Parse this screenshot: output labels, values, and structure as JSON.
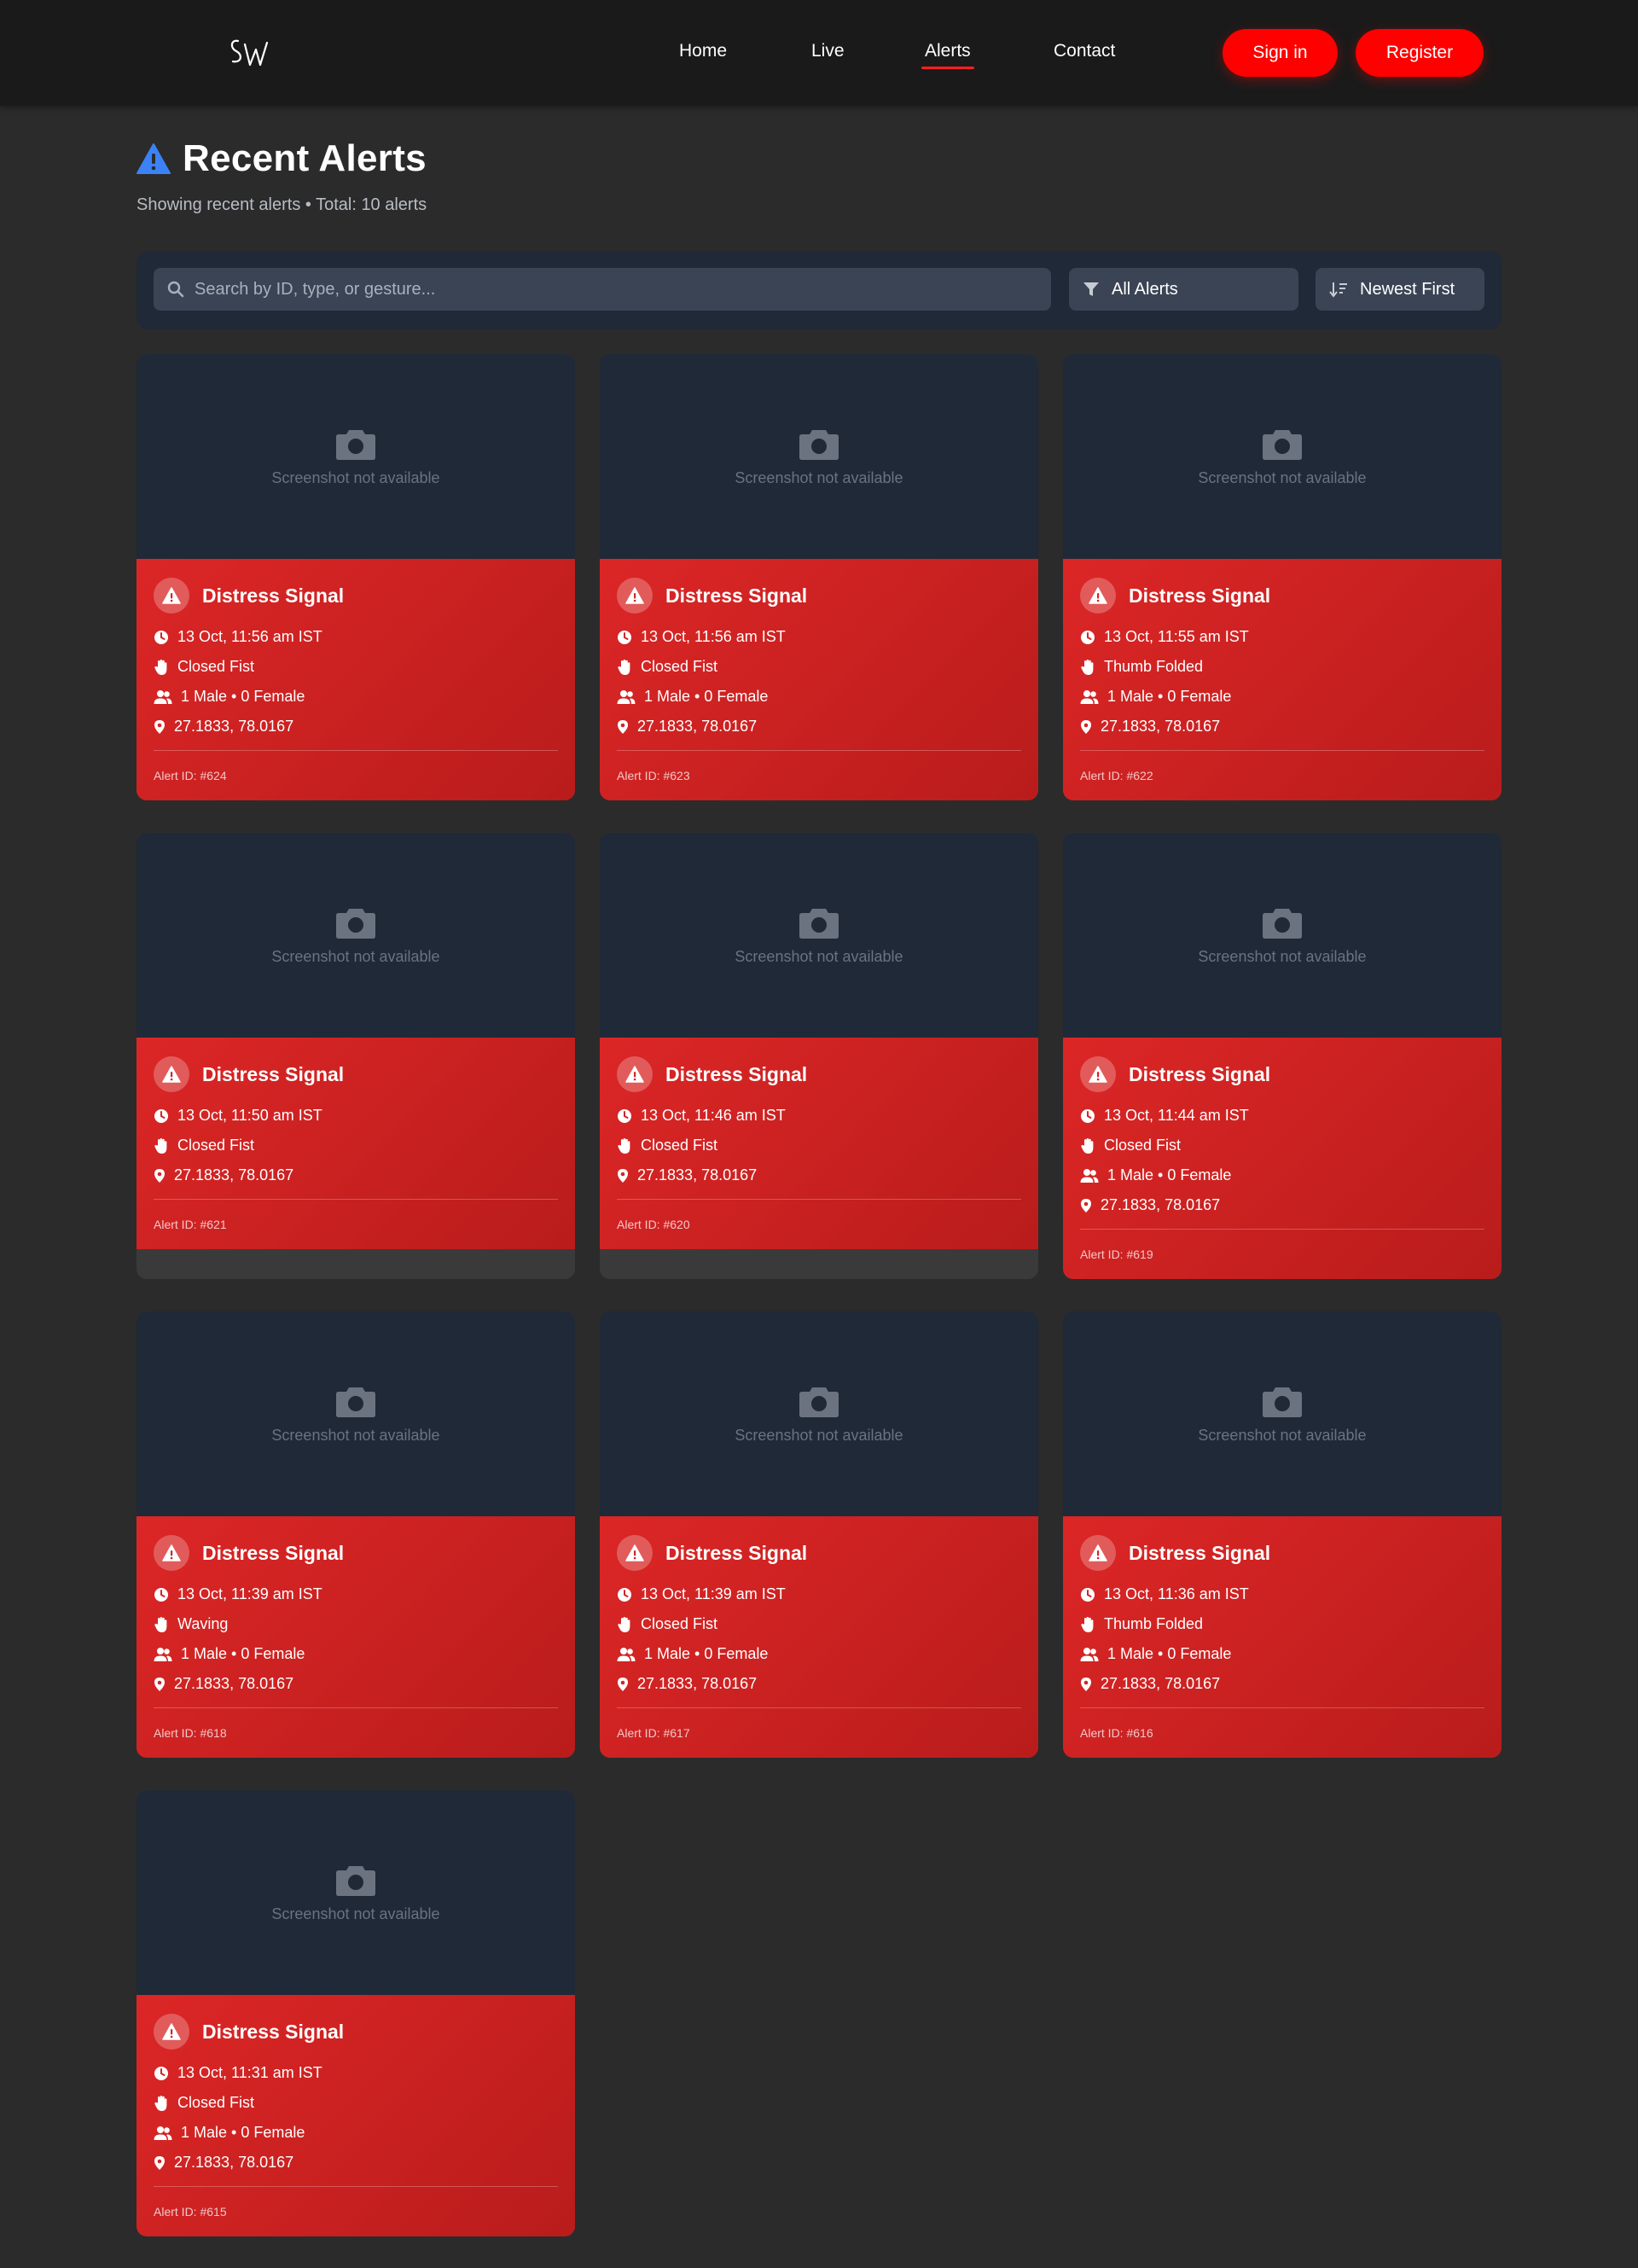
{
  "nav": {
    "logo_text": "SW",
    "links": [
      {
        "label": "Home",
        "active": false
      },
      {
        "label": "Live",
        "active": false
      },
      {
        "label": "Alerts",
        "active": true
      },
      {
        "label": "Contact",
        "active": false
      }
    ],
    "signin_label": "Sign in",
    "register_label": "Register"
  },
  "header": {
    "title": "Recent Alerts",
    "subtitle": "Showing recent alerts • Total: 10 alerts",
    "icon": "warning-icon"
  },
  "filters": {
    "search_placeholder": "Search by ID, type, or gesture...",
    "type_filter": "All Alerts",
    "sort": "Newest First"
  },
  "colors": {
    "accent": "#ff0000",
    "card_red": "#dc2626",
    "title_icon": "#3b82f6",
    "panel": "#1f2937",
    "background": "#2b2b2b"
  },
  "screenshot_placeholder": "Screenshot not available",
  "alerts": [
    {
      "title": "Distress Signal",
      "time": "13 Oct, 11:56 am IST",
      "gesture": "Closed Fist",
      "people": "1 Male • 0 Female",
      "location": "27.1833, 78.0167",
      "id": "Alert ID: #624"
    },
    {
      "title": "Distress Signal",
      "time": "13 Oct, 11:56 am IST",
      "gesture": "Closed Fist",
      "people": "1 Male • 0 Female",
      "location": "27.1833, 78.0167",
      "id": "Alert ID: #623"
    },
    {
      "title": "Distress Signal",
      "time": "13 Oct, 11:55 am IST",
      "gesture": "Thumb Folded",
      "people": "1 Male • 0 Female",
      "location": "27.1833, 78.0167",
      "id": "Alert ID: #622"
    },
    {
      "title": "Distress Signal",
      "time": "13 Oct, 11:50 am IST",
      "gesture": "Closed Fist",
      "people": null,
      "location": "27.1833, 78.0167",
      "id": "Alert ID: #621"
    },
    {
      "title": "Distress Signal",
      "time": "13 Oct, 11:46 am IST",
      "gesture": "Closed Fist",
      "people": null,
      "location": "27.1833, 78.0167",
      "id": "Alert ID: #620"
    },
    {
      "title": "Distress Signal",
      "time": "13 Oct, 11:44 am IST",
      "gesture": "Closed Fist",
      "people": "1 Male • 0 Female",
      "location": "27.1833, 78.0167",
      "id": "Alert ID: #619"
    },
    {
      "title": "Distress Signal",
      "time": "13 Oct, 11:39 am IST",
      "gesture": "Waving",
      "people": "1 Male • 0 Female",
      "location": "27.1833, 78.0167",
      "id": "Alert ID: #618"
    },
    {
      "title": "Distress Signal",
      "time": "13 Oct, 11:39 am IST",
      "gesture": "Closed Fist",
      "people": "1 Male • 0 Female",
      "location": "27.1833, 78.0167",
      "id": "Alert ID: #617"
    },
    {
      "title": "Distress Signal",
      "time": "13 Oct, 11:36 am IST",
      "gesture": "Thumb Folded",
      "people": "1 Male • 0 Female",
      "location": "27.1833, 78.0167",
      "id": "Alert ID: #616"
    },
    {
      "title": "Distress Signal",
      "time": "13 Oct, 11:31 am IST",
      "gesture": "Closed Fist",
      "people": "1 Male • 0 Female",
      "location": "27.1833, 78.0167",
      "id": "Alert ID: #615"
    }
  ]
}
